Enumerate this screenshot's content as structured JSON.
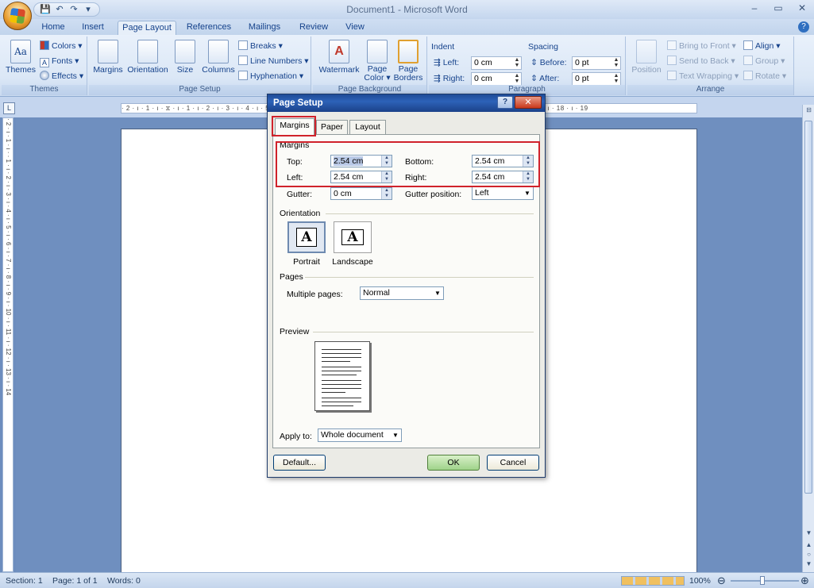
{
  "window": {
    "title": "Document1 - Microsoft Word",
    "minimize": "–",
    "maximize": "▭",
    "close": "✕"
  },
  "qat": {
    "save": "💾",
    "undo": "↶",
    "redo": "↷",
    "more": "▾"
  },
  "tabs": [
    "Home",
    "Insert",
    "Page Layout",
    "References",
    "Mailings",
    "Review",
    "View"
  ],
  "active_tab": "Page Layout",
  "help": "?",
  "ribbon": {
    "themes": {
      "label": "Themes",
      "themes_btn": "Themes",
      "colors": "Colors ▾",
      "fonts": "Fonts ▾",
      "effects": "Effects ▾"
    },
    "page_setup": {
      "label": "Page Setup",
      "margins": "Margins",
      "orientation": "Orientation",
      "size": "Size",
      "columns": "Columns",
      "breaks": "Breaks ▾",
      "line_numbers": "Line Numbers ▾",
      "hyphenation": "Hyphenation ▾"
    },
    "page_background": {
      "label": "Page Background",
      "watermark": "Watermark",
      "page_color_1": "Page",
      "page_color_2": "Color ▾",
      "page_borders_1": "Page",
      "page_borders_2": "Borders"
    },
    "paragraph": {
      "label": "Paragraph",
      "indent": "Indent",
      "left": "Left:",
      "left_val": "0 cm",
      "right": "Right:",
      "right_val": "0 cm",
      "spacing": "Spacing",
      "before": "Before:",
      "before_val": "0 pt",
      "after": "After:",
      "after_val": "0 pt"
    },
    "arrange": {
      "label": "Arrange",
      "position": "Position",
      "bring_to_front": "Bring to Front ▾",
      "send_to_back": "Send to Back ▾",
      "text_wrapping": "Text Wrapping ▾",
      "align": "Align ▾",
      "group": "Group ▾",
      "rotate": "Rotate ▾"
    }
  },
  "ruler": {
    "h_text": "· 2 · ı · 1 · ı · ⧖ · ı · 1 · ı · 2 · ı · 3 · ı · 4 · ı · 5 · ı · 6 · ı · 7 · ı · 8 · ı · 9 · ı · 10 · ı · 11 · ı · 12 · ı · 13 · ı · 14 · ı · 15 · ı · 16 · △ · 17 · ı · 18 · ı · 19",
    "v_text": "· 2 · ı · 1 · ı · · 1 · ı · 2 · ı · 3 · ı · 4 · ı · 5 · ı · 6 · ı · 7 · ı · 8 · ı · 9 · ı · 10 · ı · 11 · ı · 12 · ı · 13 · ı · 14",
    "tab_selector": "L"
  },
  "status": {
    "section": "Section: 1",
    "page": "Page: 1 of 1",
    "words": "Words: 0",
    "zoom": "100%",
    "zoom_out": "⊖",
    "zoom_in": "⊕"
  },
  "dialog": {
    "title": "Page Setup",
    "help": "?",
    "close": "✕",
    "tabs": [
      "Margins",
      "Paper",
      "Layout"
    ],
    "margins_section": "Margins",
    "top_label": "Top:",
    "top_val": "2.54 cm",
    "bottom_label": "Bottom:",
    "bottom_val": "2.54 cm",
    "left_label": "Left:",
    "left_val": "2.54 cm",
    "right_label": "Right:",
    "right_val": "2.54 cm",
    "gutter_label": "Gutter:",
    "gutter_val": "0 cm",
    "gutter_pos_label": "Gutter position:",
    "gutter_pos_val": "Left",
    "orientation_section": "Orientation",
    "portrait": "Portrait",
    "landscape": "Landscape",
    "pages_section": "Pages",
    "multiple_pages_label": "Multiple pages:",
    "multiple_pages_val": "Normal",
    "preview_section": "Preview",
    "apply_to_label": "Apply to:",
    "apply_to_val": "Whole document",
    "default_btn": "Default...",
    "ok_btn": "OK",
    "cancel_btn": "Cancel"
  }
}
